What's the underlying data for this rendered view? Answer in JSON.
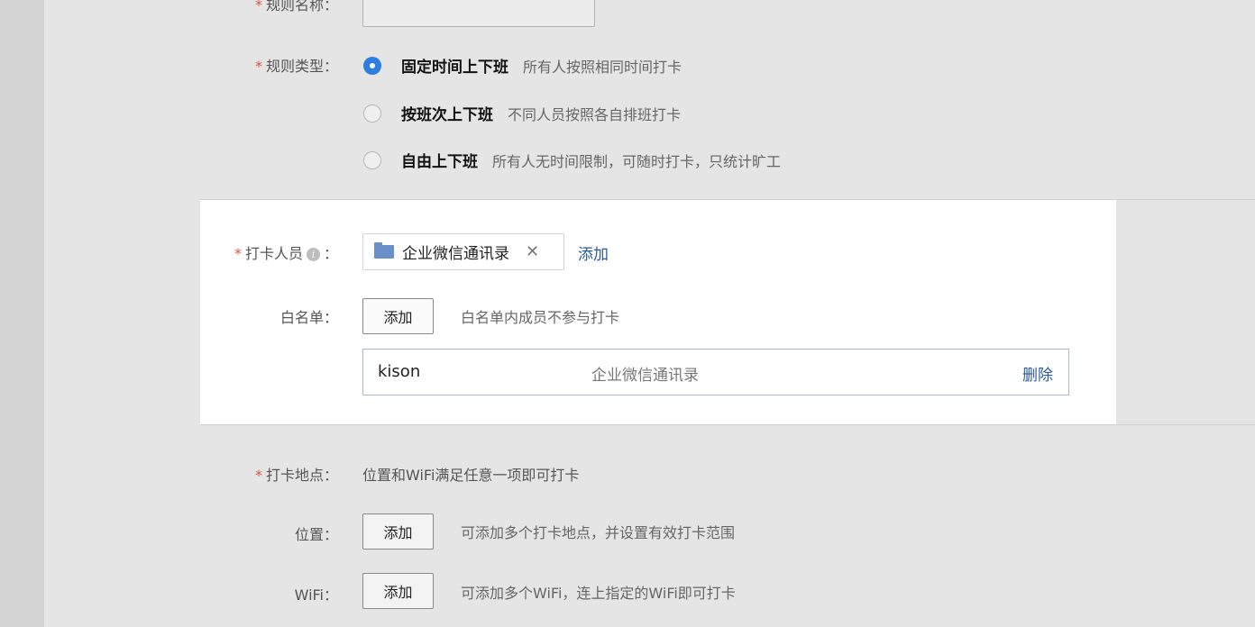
{
  "fields": {
    "rule_name": {
      "label": "规则名称：",
      "value": ""
    },
    "rule_type": {
      "label": "规则类型：",
      "options": [
        {
          "title": "固定时间上下班",
          "desc": "所有人按照相同时间打卡",
          "selected": true
        },
        {
          "title": "按班次上下班",
          "desc": "不同人员按照各自排班打卡",
          "selected": false
        },
        {
          "title": "自由上下班",
          "desc": "所有人无时间限制，可随时打卡，只统计旷工",
          "selected": false
        }
      ]
    },
    "members": {
      "label": "打卡人员",
      "colon": "：",
      "tag": "企业微信通讯录",
      "add_link": "添加"
    },
    "whitelist": {
      "label": "白名单：",
      "add_button": "添加",
      "hint": "白名单内成员不参与打卡",
      "rows": [
        {
          "name": "kison",
          "source": "企业微信通讯录",
          "action": "删除"
        }
      ]
    },
    "location_rule": {
      "label": "打卡地点：",
      "desc": "位置和WiFi满足任意一项即可打卡"
    },
    "position": {
      "label": "位置：",
      "add_button": "添加",
      "hint": "可添加多个打卡地点，并设置有效打卡范围"
    },
    "wifi": {
      "label": "WiFi：",
      "add_button": "添加",
      "hint": "可添加多个WiFi，连上指定的WiFi即可打卡"
    }
  },
  "colors": {
    "accent": "#2c7ee0",
    "link": "#2a5a97",
    "required": "#d9534f"
  }
}
